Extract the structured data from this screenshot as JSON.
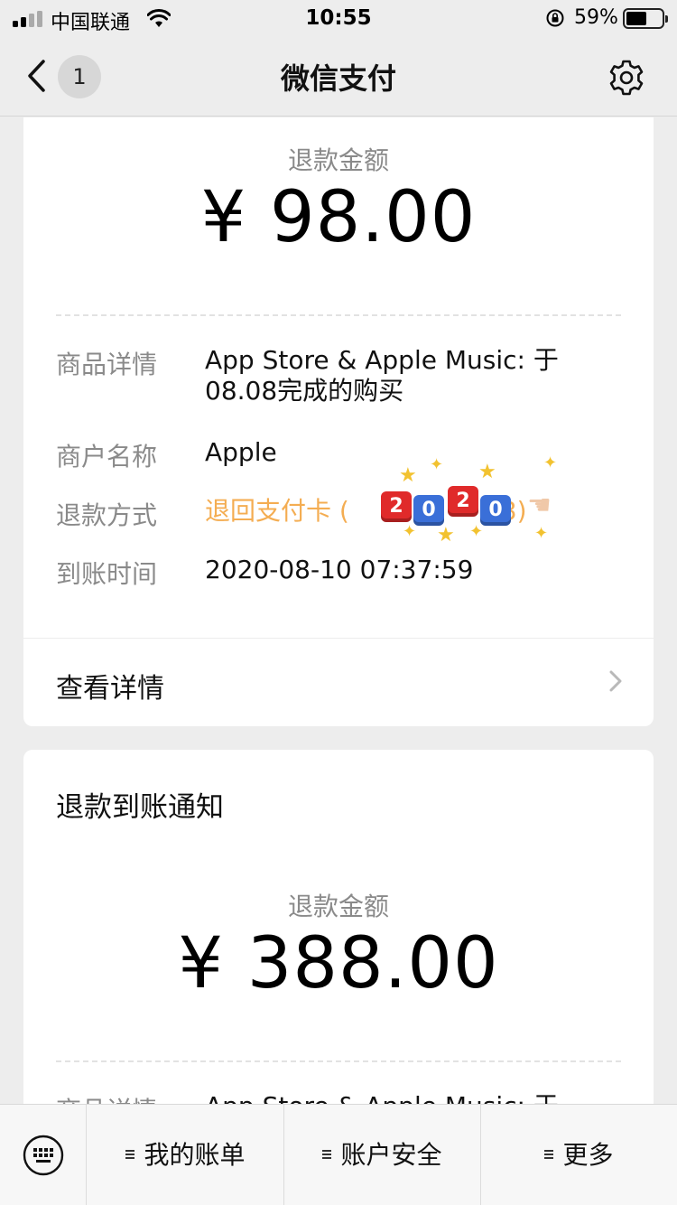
{
  "status_bar": {
    "carrier": "中国联通",
    "time": "10:55",
    "battery_percent": "59%"
  },
  "nav": {
    "title": "微信支付",
    "badge_count": "1"
  },
  "card1": {
    "amount_label": "退款金额",
    "amount": "¥ 98.00",
    "rows": [
      {
        "label": "商品详情",
        "value_line1": "App Store & Apple Music: 于",
        "value_line2": "08.08完成的购买"
      },
      {
        "label": "商户名称",
        "value": "Apple"
      },
      {
        "label": "退款方式",
        "value": "退回支付卡 (",
        "value_tail": "3)"
      },
      {
        "label": "到账时间",
        "value": "2020-08-10 07:37:59"
      }
    ],
    "detail_link": "查看详情",
    "sticker_digits": [
      "2",
      "0",
      "2",
      "0"
    ]
  },
  "card2": {
    "title": "退款到账通知",
    "amount_label": "退款金额",
    "amount": "¥ 388.00",
    "partial_row_label": "商品详情",
    "partial_row_value": "App Store & Apple Music: 于"
  },
  "bottom_bar": {
    "tabs": [
      {
        "label": "我的账单"
      },
      {
        "label": "账户安全"
      },
      {
        "label": "更多"
      }
    ]
  },
  "colors": {
    "accent_orange": "#f4ad52",
    "page_bg": "#ededed",
    "card_bg": "#ffffff",
    "muted_text": "#8a8a8a"
  },
  "icons": [
    "signal-icon",
    "wifi-icon",
    "orientation-lock-icon",
    "battery-icon",
    "back-chevron-icon",
    "gear-icon",
    "chevron-right-icon",
    "keyboard-icon",
    "menu-icon"
  ]
}
